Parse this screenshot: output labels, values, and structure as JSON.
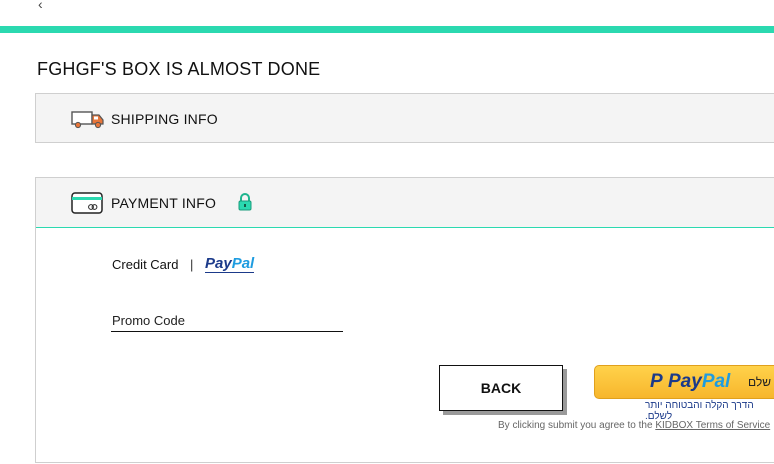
{
  "header": {
    "back_glyph": "‹"
  },
  "page": {
    "title": "FGHGF'S BOX IS ALMOST DONE"
  },
  "shipping": {
    "label": "SHIPPING INFO"
  },
  "payment": {
    "label": "PAYMENT INFO",
    "method_credit": "Credit Card",
    "separator": "|",
    "paypal_pay": "Pay",
    "paypal_pal": "Pal",
    "promo_placeholder": "Promo Code",
    "back_label": "BACK",
    "paypal_button": {
      "p": "P",
      "pay": "Pay",
      "pal": "Pal",
      "hebrew_pay": "שלם",
      "tagline": "הדרך הקלה והבטוחה יותר לשלם."
    },
    "terms_prefix": "By clicking submit you agree to the ",
    "terms_link": "KIDBOX Terms of Service"
  },
  "colors": {
    "accent": "#2bd9b0",
    "paypal_dark": "#1b3a8a",
    "paypal_light": "#1e9ce0",
    "paypal_button": "#f7b62d",
    "lock": "#2bd9b0"
  },
  "icons": [
    "truck-icon",
    "credit-card-icon",
    "lock-icon",
    "back-chevron-icon"
  ]
}
